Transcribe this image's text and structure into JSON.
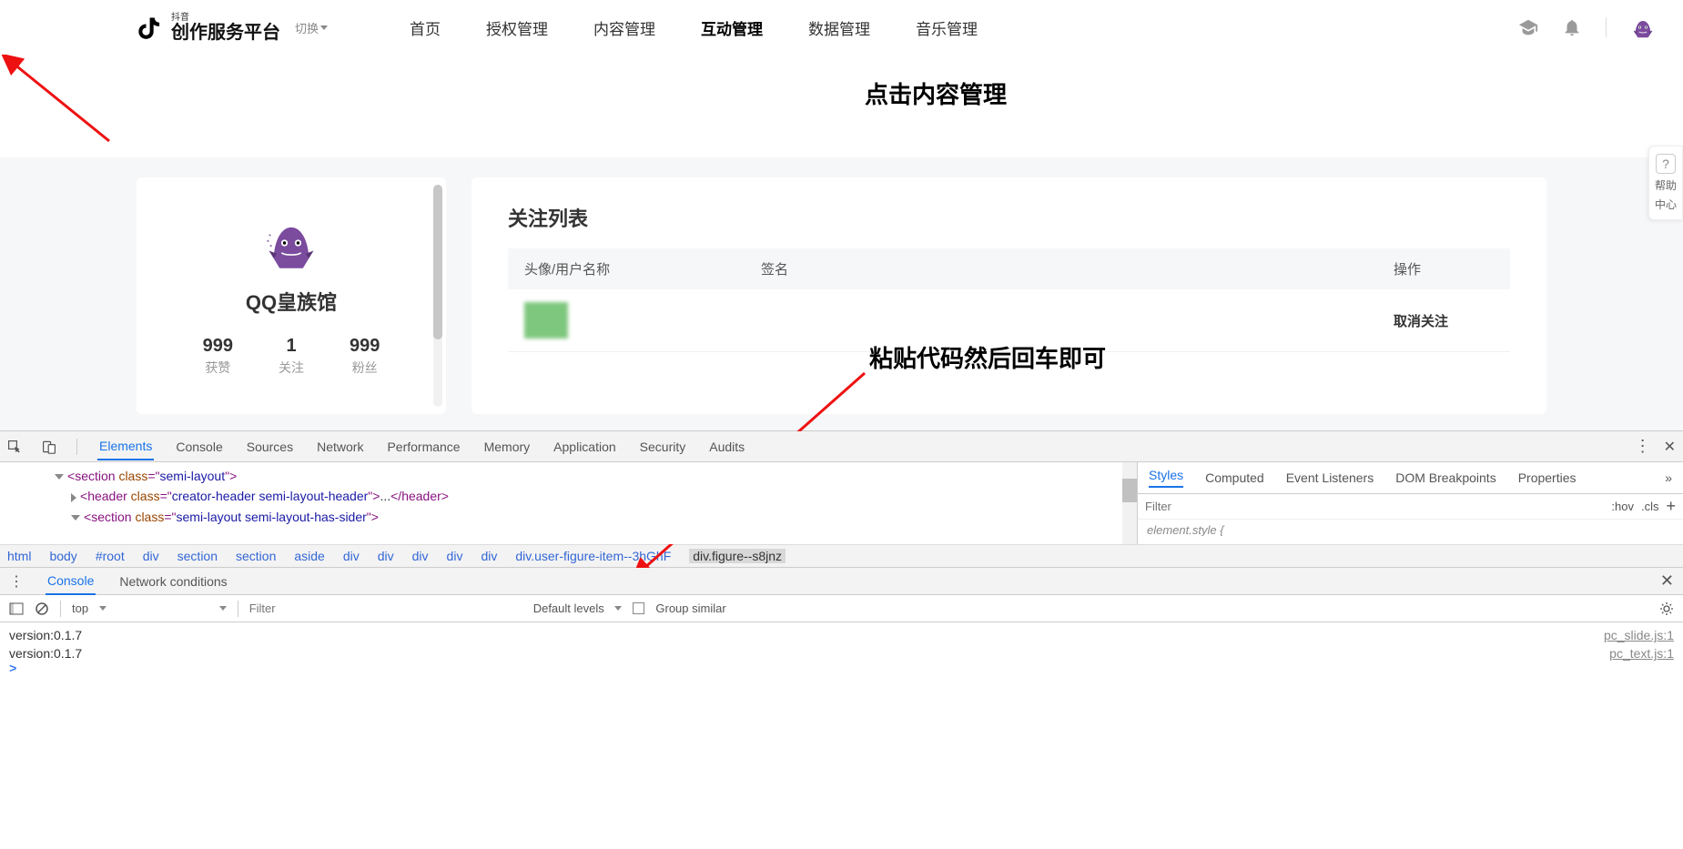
{
  "header": {
    "logo_small": "抖音",
    "logo_big": "创作服务平台",
    "switch": "切换",
    "nav": [
      "首页",
      "授权管理",
      "内容管理",
      "互动管理",
      "数据管理",
      "音乐管理"
    ],
    "active_nav_index": 3
  },
  "annotations": {
    "top": "点击内容管理",
    "mid": "粘贴代码然后回车即可"
  },
  "help": {
    "label1": "帮助",
    "label2": "中心"
  },
  "profile": {
    "name": "QQ皇族馆",
    "stats": [
      {
        "value": "999",
        "label": "获赞"
      },
      {
        "value": "1",
        "label": "关注"
      },
      {
        "value": "999",
        "label": "粉丝"
      }
    ]
  },
  "follow_list": {
    "title": "关注列表",
    "columns": {
      "user": "头像/用户名称",
      "sig": "签名",
      "op": "操作"
    },
    "row_action": "取消关注"
  },
  "devtools": {
    "tabs": [
      "Elements",
      "Console",
      "Sources",
      "Network",
      "Performance",
      "Memory",
      "Application",
      "Security",
      "Audits"
    ],
    "active_tab_index": 0,
    "dom": {
      "line1_pre": "<section ",
      "line1_attr": "class",
      "line1_val": "semi-layout",
      "line1_post": ">",
      "line2_pre": "<header ",
      "line2_attr": "class",
      "line2_val": "creator-header semi-layout-header",
      "line2_mid": ">...",
      "line2_end": "</header>",
      "line3_pre": "<section ",
      "line3_attr": "class",
      "line3_val": "semi-layout semi-layout-has-sider",
      "line3_post": ">"
    },
    "crumbs": [
      "html",
      "body",
      "#root",
      "div",
      "section",
      "section",
      "aside",
      "div",
      "div",
      "div",
      "div",
      "div",
      "div.user-figure-item--3hGhF",
      "div.figure--s8jnz"
    ],
    "selected_crumb_index": 13,
    "styles": {
      "tabs": [
        "Styles",
        "Computed",
        "Event Listeners",
        "DOM Breakpoints",
        "Properties"
      ],
      "active_index": 0,
      "filter_placeholder": "Filter",
      "hov": ":hov",
      "cls": ".cls",
      "body_hint": "element.style {"
    },
    "drawer_tabs": [
      "Console",
      "Network conditions"
    ],
    "active_drawer_index": 0,
    "console_toolbar": {
      "context": "top",
      "filter_placeholder": "Filter",
      "levels": "Default levels",
      "group": "Group similar"
    },
    "console": [
      {
        "msg": "version:0.1.7",
        "src": "pc_slide.js:1"
      },
      {
        "msg": "version:0.1.7",
        "src": "pc_text.js:1"
      }
    ]
  }
}
